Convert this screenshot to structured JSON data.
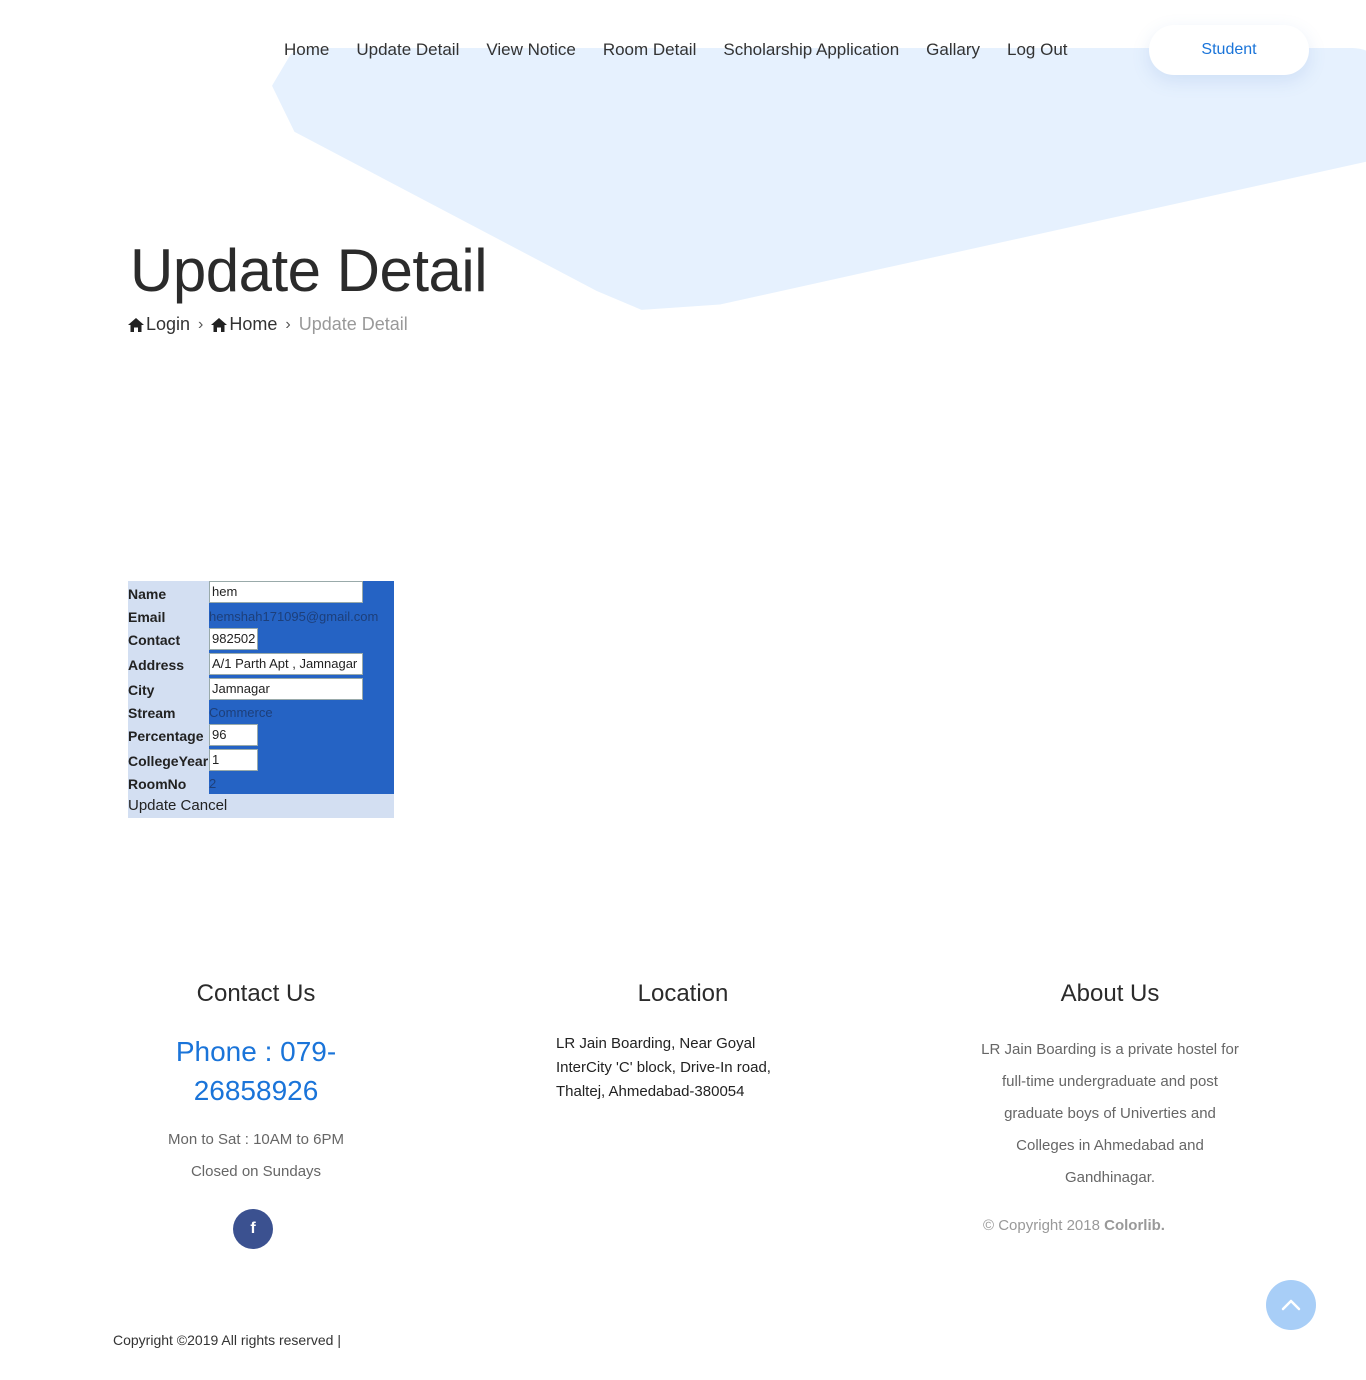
{
  "nav": {
    "items": [
      "Home",
      "Update Detail",
      "View Notice",
      "Room Detail",
      "Scholarship Application",
      "Gallary",
      "Log Out"
    ],
    "user_button": "Student"
  },
  "page": {
    "title": "Update Detail",
    "breadcrumb": [
      "Login",
      "Home",
      "Update Detail"
    ]
  },
  "form": {
    "labels": {
      "name": "Name",
      "email": "Email",
      "contact": "Contact",
      "address": "Address",
      "city": "City",
      "stream": "Stream",
      "percentage": "Percentage",
      "college_year": "CollegeYear",
      "room_no": "RoomNo"
    },
    "values": {
      "name": "hem",
      "email": "hemshah171095@gmail.com",
      "contact": "982502",
      "address": "A/1 Parth Apt , Jamnagar",
      "city": "Jamnagar",
      "stream": "Commerce",
      "percentage": "96",
      "college_year": "1",
      "room_no": "2"
    },
    "update_label": "Update",
    "cancel_label": "Cancel"
  },
  "footer": {
    "contact_title": "Contact Us",
    "phone": "Phone : 079-26858926",
    "hours": "Mon to Sat : 10AM to 6PM",
    "closed": "Closed on Sundays",
    "facebook_icon_glyph": "f",
    "location_title": "Location",
    "location_text": "LR Jain Boarding, Near Goyal InterCity 'C' block, Drive-In road, Thaltej, Ahmedabad-380054",
    "about_title": "About Us",
    "about_text": "LR Jain Boarding is a private hostel for full-time undergraduate and post graduate boys of Univerties and Colleges in Ahmedabad and Gandhinagar.",
    "copyright_prefix": "© Copyright 2018",
    "copyright_brand": "Colorlib.",
    "copyright_bottom": "Copyright ©2019 All rights reserved |"
  },
  "colors": {
    "accent": "#1a74d9",
    "form_blue": "#2563c4",
    "form_label_bg": "#d3dff2",
    "hero_shape": "#e6f1fe",
    "facebook": "#3b5190",
    "scroll_up": "#a8cef7"
  },
  "icons": [
    "home-icon",
    "chevron-right-icon",
    "facebook-icon",
    "chevron-up-icon"
  ]
}
